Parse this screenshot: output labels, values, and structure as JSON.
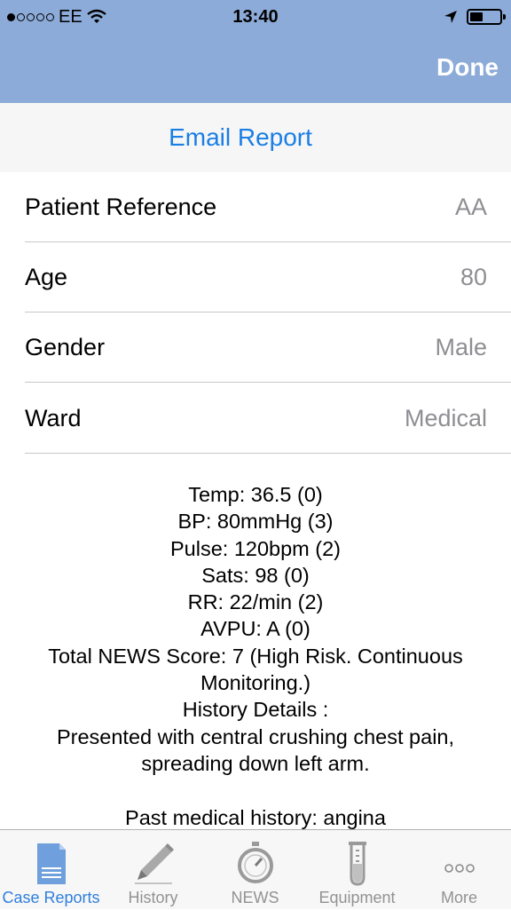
{
  "status_bar": {
    "carrier": "EE",
    "time": "13:40",
    "signal_dots_filled": 1,
    "signal_dots_total": 5
  },
  "nav": {
    "done_label": "Done",
    "bar_color": "#8cabd8"
  },
  "email_report_label": "Email Report",
  "rows": [
    {
      "label": "Patient Reference",
      "value": "AA"
    },
    {
      "label": "Age",
      "value": "80"
    },
    {
      "label": "Gender",
      "value": "Male"
    },
    {
      "label": "Ward",
      "value": "Medical"
    }
  ],
  "summary_lines": [
    "Temp: 36.5 (0)",
    "BP: 80mmHg (3)",
    "Pulse: 120bpm (2)",
    "Sats: 98 (0)",
    "RR: 22/min (2)",
    "AVPU: A (0)",
    "Total NEWS Score: 7 (High Risk. Continuous Monitoring.)",
    "History Details :",
    "Presented with central crushing chest pain, spreading down left arm.",
    "",
    "Past medical history: angina"
  ],
  "tabs": [
    {
      "label": "Case Reports",
      "icon": "document-icon",
      "active": true
    },
    {
      "label": "History",
      "icon": "pencil-icon",
      "active": false
    },
    {
      "label": "NEWS",
      "icon": "stopwatch-icon",
      "active": false
    },
    {
      "label": "Equipment",
      "icon": "test-tube-icon",
      "active": false
    },
    {
      "label": "More",
      "icon": "more-dots-icon",
      "active": false
    }
  ],
  "colors": {
    "accent": "#1a7ee5",
    "tab_active": "#2f7fdc",
    "tab_inactive": "#929292",
    "value_gray": "#8e8e93"
  }
}
